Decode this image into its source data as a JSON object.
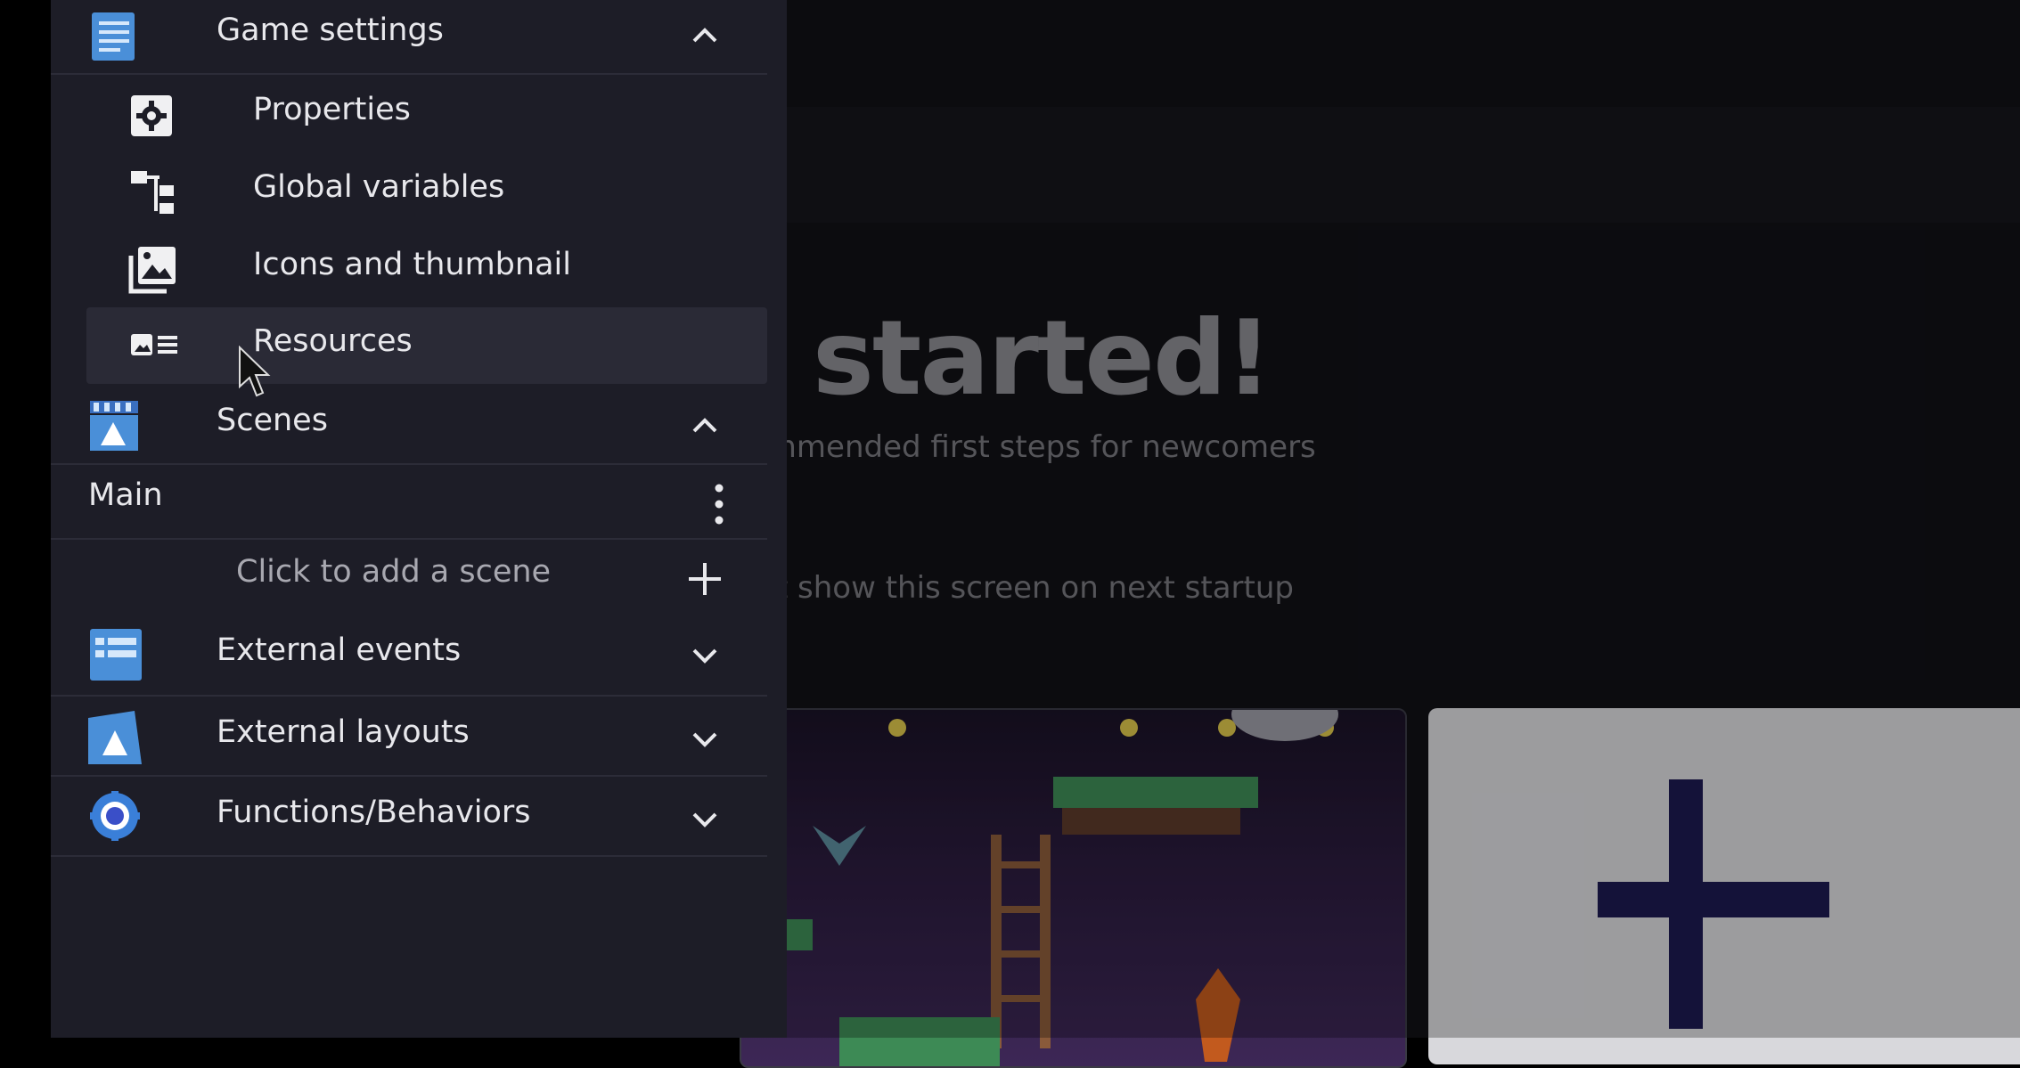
{
  "sidebar": {
    "game_settings": {
      "label": "Game settings",
      "items": [
        {
          "label": "Properties",
          "icon": "gear-icon"
        },
        {
          "label": "Global variables",
          "icon": "variables-tree-icon"
        },
        {
          "label": "Icons and thumbnail",
          "icon": "image-icon"
        },
        {
          "label": "Resources",
          "icon": "resources-icon"
        }
      ]
    },
    "scenes": {
      "label": "Scenes",
      "items": [
        {
          "label": "Main"
        }
      ],
      "add_label": "Click to add a scene"
    },
    "external_events": {
      "label": "External events"
    },
    "external_layouts": {
      "label": "External layouts"
    },
    "functions_behaviors": {
      "label": "Functions/Behaviors"
    }
  },
  "background": {
    "title": "t started!",
    "subtitle": "ommended first steps for newcomers",
    "checkbox_label": "n't show this screen on next startup"
  },
  "colors": {
    "sidebar_bg": "#1d1d27",
    "main_bg": "#111116",
    "plus_color": "#1c1a4f"
  }
}
